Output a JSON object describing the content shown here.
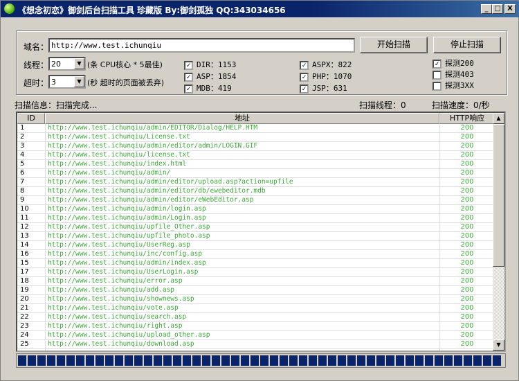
{
  "window": {
    "title": "《想念初恋》御剑后台扫描工具 珍藏版 By:御剑孤独 QQ:343034656",
    "min": "_",
    "max": "□",
    "close": "X"
  },
  "form": {
    "domain_label": "域名：",
    "domain_value": "http://www.test.ichunqiu",
    "start_button": "开始扫描",
    "stop_button": "停止扫描",
    "threads_label": "线程：",
    "threads_value": "20",
    "threads_hint": "(条 CPU核心 * 5最佳)",
    "timeout_label": "超时：",
    "timeout_value": "3",
    "timeout_hint": "(秒 超时的页面被丢弃)",
    "dicts": [
      {
        "label": "DIR：1153",
        "checked": true
      },
      {
        "label": "ASP：1854",
        "checked": true
      },
      {
        "label": "MDB：419",
        "checked": true
      },
      {
        "label": "ASPX：822",
        "checked": true
      },
      {
        "label": "PHP：1070",
        "checked": true
      },
      {
        "label": "JSP：631",
        "checked": true
      }
    ],
    "probes": [
      {
        "label": "探测200",
        "checked": true
      },
      {
        "label": "探测403",
        "checked": false
      },
      {
        "label": "探测3XX",
        "checked": false
      }
    ]
  },
  "status": {
    "info": "扫描信息：扫描完成...",
    "threads": "扫描线程：0",
    "speed": "扫描速度：0/秒"
  },
  "table": {
    "columns": [
      "ID",
      "地址",
      "HTTP响应"
    ],
    "rows": [
      [
        "1",
        "http://www.test.ichunqiu/admin/EDITOR/Dialog/HELP.HTM",
        "200"
      ],
      [
        "2",
        "http://www.test.ichunqiu/License.txt",
        "200"
      ],
      [
        "3",
        "http://www.test.ichunqiu/admin/editor/admin/LOGIN.GIF",
        "200"
      ],
      [
        "4",
        "http://www.test.ichunqiu/license.txt",
        "200"
      ],
      [
        "5",
        "http://www.test.ichunqiu/index.html",
        "200"
      ],
      [
        "6",
        "http://www.test.ichunqiu/admin/",
        "200"
      ],
      [
        "7",
        "http://www.test.ichunqiu/admin/editor/upload.asp?action=upfile",
        "200"
      ],
      [
        "8",
        "http://www.test.ichunqiu/admin/editor/db/ewebeditor.mdb",
        "200"
      ],
      [
        "9",
        "http://www.test.ichunqiu/admin/editor/eWebEditor.asp",
        "200"
      ],
      [
        "10",
        "http://www.test.ichunqiu/admin/login.asp",
        "200"
      ],
      [
        "11",
        "http://www.test.ichunqiu/admin/Login.asp",
        "200"
      ],
      [
        "12",
        "http://www.test.ichunqiu/upfile_Other.asp",
        "200"
      ],
      [
        "13",
        "http://www.test.ichunqiu/upfile_photo.asp",
        "200"
      ],
      [
        "14",
        "http://www.test.ichunqiu/UserReg.asp",
        "200"
      ],
      [
        "16",
        "http://www.test.ichunqiu/inc/config.asp",
        "200"
      ],
      [
        "15",
        "http://www.test.ichunqiu/admin/index.asp",
        "200"
      ],
      [
        "17",
        "http://www.test.ichunqiu/UserLogin.asp",
        "200"
      ],
      [
        "18",
        "http://www.test.ichunqiu/error.asp",
        "200"
      ],
      [
        "19",
        "http://www.test.ichunqiu/add.asp",
        "200"
      ],
      [
        "20",
        "http://www.test.ichunqiu/shownews.asp",
        "200"
      ],
      [
        "21",
        "http://www.test.ichunqiu/vote.asp",
        "200"
      ],
      [
        "22",
        "http://www.test.ichunqiu/search.asp",
        "200"
      ],
      [
        "23",
        "http://www.test.ichunqiu/right.asp",
        "200"
      ],
      [
        "24",
        "http://www.test.ichunqiu/upload_other.asp",
        "200"
      ],
      [
        "25",
        "http://www.test.ichunqiu/download.asp",
        "200"
      ]
    ]
  },
  "progress": {
    "percent": 100
  },
  "colors": {
    "titlebar": "#0a246a",
    "url_text": "#3aaa35",
    "progress": "#0a246a"
  }
}
